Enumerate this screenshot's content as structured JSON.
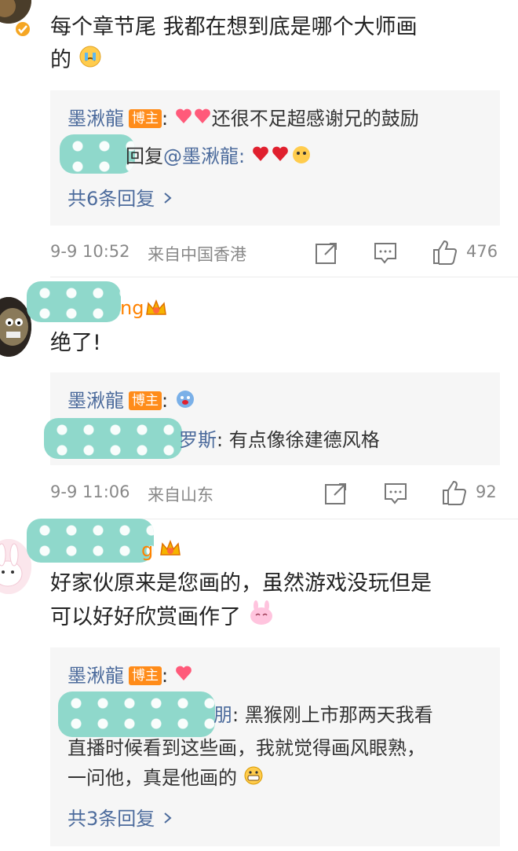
{
  "comments": [
    {
      "text_line1": "每个章节尾 我都在想到底是哪个大师画",
      "text_line2": "的",
      "reply": {
        "author": "墨湫龍",
        "badge": "博主",
        "text": "还很不足超感谢兄的鼓励",
        "second_line_prefix": "回复",
        "second_line_mention": "@墨湫龍:",
        "more": "共6条回复"
      },
      "time": "9-9 10:52",
      "location": "来自中国香港",
      "likes": "476"
    },
    {
      "name_suffix": "ng",
      "text": "绝了!",
      "reply": {
        "author": "墨湫龍",
        "badge": "博主",
        "second_line_name_tail": "罗斯",
        "second_line_text": ": 有点像徐建德风格"
      },
      "time": "9-9 11:06",
      "location": "来自山东",
      "likes": "92"
    },
    {
      "name_suffix": "g",
      "text_line1": "好家伙原来是您画的，虽然游戏没玩但是",
      "text_line2": "可以好好欣赏画作了",
      "reply": {
        "author": "墨湫龍",
        "badge": "博主",
        "line1_name_tail": "朋",
        "line1_text": ": 黑猴刚上市那两天我看",
        "line2": "直播时候看到这些画，我就觉得画风眼熟，",
        "line3": "一问他，真是他画的",
        "more": "共3条回复"
      }
    }
  ],
  "colors": {
    "link": "#4c6b9c",
    "badge": "#ff8c1a",
    "blur": "#8fd8cb"
  },
  "icons": [
    "share-icon",
    "comment-icon",
    "like-icon",
    "more-chevron-icon",
    "verified-badge-icon",
    "crown-badge-icon"
  ]
}
